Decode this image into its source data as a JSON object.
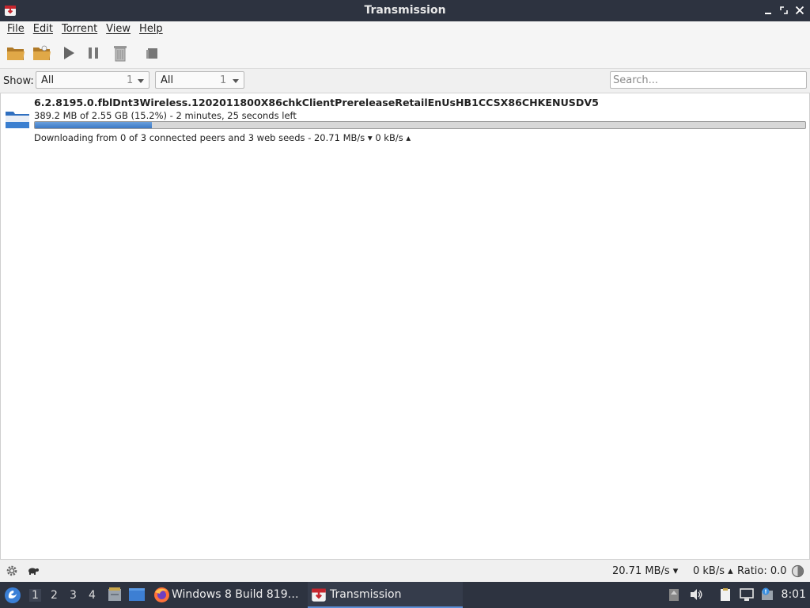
{
  "window": {
    "title": "Transmission"
  },
  "menubar": {
    "items": [
      {
        "key": "F",
        "rest": "ile"
      },
      {
        "key": "E",
        "rest": "dit"
      },
      {
        "key": "T",
        "rest": "orrent"
      },
      {
        "key": "V",
        "rest": "iew"
      },
      {
        "key": "H",
        "rest": "elp"
      }
    ]
  },
  "toolbar": {
    "buttons": [
      "open-torrent-icon",
      "open-url-icon",
      "start-icon",
      "pause-icon",
      "remove-icon",
      "properties-icon"
    ]
  },
  "filterbar": {
    "show_label": "Show:",
    "activity_filter": {
      "value": "All",
      "count": "1"
    },
    "tracker_filter": {
      "value": "All",
      "count": "1"
    },
    "search_placeholder": "Search..."
  },
  "torrents": [
    {
      "name": "6.2.8195.0.fblDnt3Wireless.1202011800X86chkClientPrereleaseRetailEnUsHB1CCSX86CHKENUSDV5",
      "progress_text": "389.2 MB of 2.55 GB (15.2%) - 2 minutes, 25 seconds left",
      "progress_fraction": 0.152,
      "status_text": "Downloading from 0 of 3 connected peers and 3 web seeds - 20.71 MB/s ▾   0 kB/s ▴"
    }
  ],
  "statusbar": {
    "download_speed": "20.71 MB/s ▾",
    "upload_speed": "0 kB/s ▴",
    "ratio": "Ratio: 0.0"
  },
  "taskbar": {
    "workspaces": [
      "1",
      "2",
      "3",
      "4"
    ],
    "tasks": [
      {
        "label": "Windows 8 Build 819…",
        "icon": "firefox-icon"
      },
      {
        "label": "Transmission",
        "icon": "transmission-icon"
      }
    ],
    "clock": "8:01"
  },
  "colors": {
    "titlebar": "#2d3340",
    "progress": "#4a86cf",
    "taskbar": "#2d3340"
  }
}
